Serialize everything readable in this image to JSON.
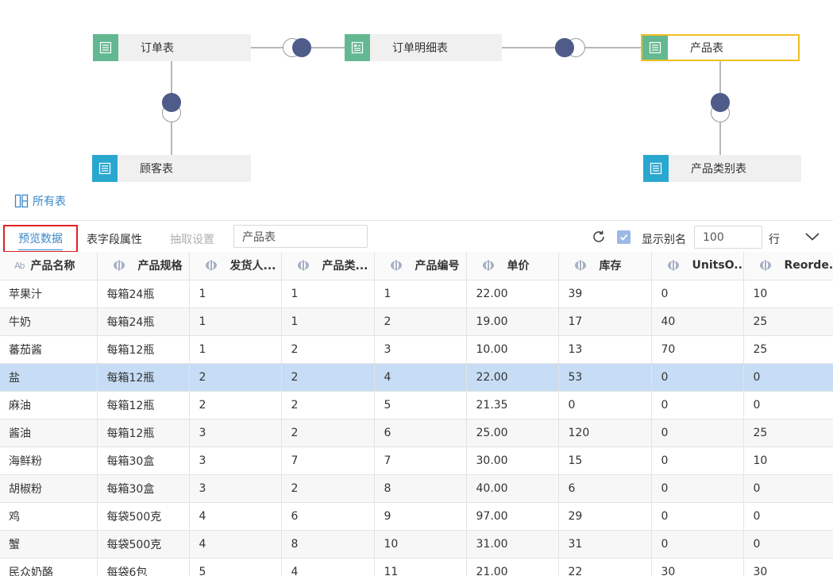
{
  "diagram": {
    "nodes": {
      "orders": "订单表",
      "order_details": "订单明细表",
      "products": "产品表",
      "customers": "顾客表",
      "categories": "产品类别表"
    },
    "colors": {
      "green": "#63b891",
      "blue": "#2aa7cf",
      "joint": "#4f5c8a",
      "selected_border": "#f0c020"
    }
  },
  "all_tables_label": "所有表",
  "toolbar": {
    "tab_preview": "预览数据",
    "tab_fields": "表字段属性",
    "tab_extract": "抽取设置",
    "table_name": "产品表",
    "show_alias": "显示别名",
    "show_alias_checked": true,
    "row_count": "100",
    "row_unit": "行"
  },
  "columns": [
    {
      "label": "产品名称",
      "icon": "text-type-icon"
    },
    {
      "label": "产品规格",
      "icon": "eye-icon"
    },
    {
      "label": "发货人...",
      "icon": "eye-icon"
    },
    {
      "label": "产品类...",
      "icon": "eye-icon"
    },
    {
      "label": "产品编号",
      "icon": "eye-icon"
    },
    {
      "label": "单价",
      "icon": "eye-icon"
    },
    {
      "label": "库存",
      "icon": "eye-icon"
    },
    {
      "label": "UnitsO...",
      "icon": "eye-icon"
    },
    {
      "label": "Reorde...",
      "icon": "eye-icon"
    }
  ],
  "rows": [
    [
      "苹果汁",
      "每箱24瓶",
      "1",
      "1",
      "1",
      "22.00",
      "39",
      "0",
      "10"
    ],
    [
      "牛奶",
      "每箱24瓶",
      "1",
      "1",
      "2",
      "19.00",
      "17",
      "40",
      "25"
    ],
    [
      "蕃茄酱",
      "每箱12瓶",
      "1",
      "2",
      "3",
      "10.00",
      "13",
      "70",
      "25"
    ],
    [
      "盐",
      "每箱12瓶",
      "2",
      "2",
      "4",
      "22.00",
      "53",
      "0",
      "0"
    ],
    [
      "麻油",
      "每箱12瓶",
      "2",
      "2",
      "5",
      "21.35",
      "0",
      "0",
      "0"
    ],
    [
      "酱油",
      "每箱12瓶",
      "3",
      "2",
      "6",
      "25.00",
      "120",
      "0",
      "25"
    ],
    [
      "海鲜粉",
      "每箱30盒",
      "3",
      "7",
      "7",
      "30.00",
      "15",
      "0",
      "10"
    ],
    [
      "胡椒粉",
      "每箱30盒",
      "3",
      "2",
      "8",
      "40.00",
      "6",
      "0",
      "0"
    ],
    [
      "鸡",
      "每袋500克",
      "4",
      "6",
      "9",
      "97.00",
      "29",
      "0",
      "0"
    ],
    [
      "蟹",
      "每袋500克",
      "4",
      "8",
      "10",
      "31.00",
      "31",
      "0",
      "0"
    ],
    [
      "民众奶酪",
      "每袋6包",
      "5",
      "4",
      "11",
      "21.00",
      "22",
      "30",
      "30"
    ]
  ],
  "selected_row": 3
}
